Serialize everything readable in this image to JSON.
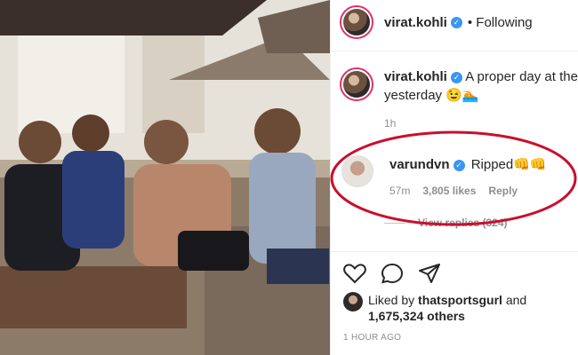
{
  "header": {
    "username": "virat.kohli",
    "follow_status": "• Following"
  },
  "caption": {
    "username": "virat.kohli",
    "text": "A proper day at the",
    "text_line2": "yesterday 😉🏊",
    "time": "1h"
  },
  "comment": {
    "username": "varundvn",
    "text": "Ripped👊👊",
    "time": "57m",
    "likes": "3,805 likes",
    "reply_label": "Reply",
    "view_replies": "View replies (324)"
  },
  "liked_by": {
    "prefix": "Liked by",
    "user": "thatsportsgurl",
    "and": "and",
    "count": "1,675,324 others"
  },
  "timestamp": "1 HOUR AGO",
  "colors": {
    "verified_blue": "#3897f0",
    "annotation_red": "#c8102e",
    "muted_gray": "#8e8e8e"
  },
  "icons": [
    "heart-icon",
    "comment-icon",
    "share-icon",
    "verified-icon"
  ]
}
